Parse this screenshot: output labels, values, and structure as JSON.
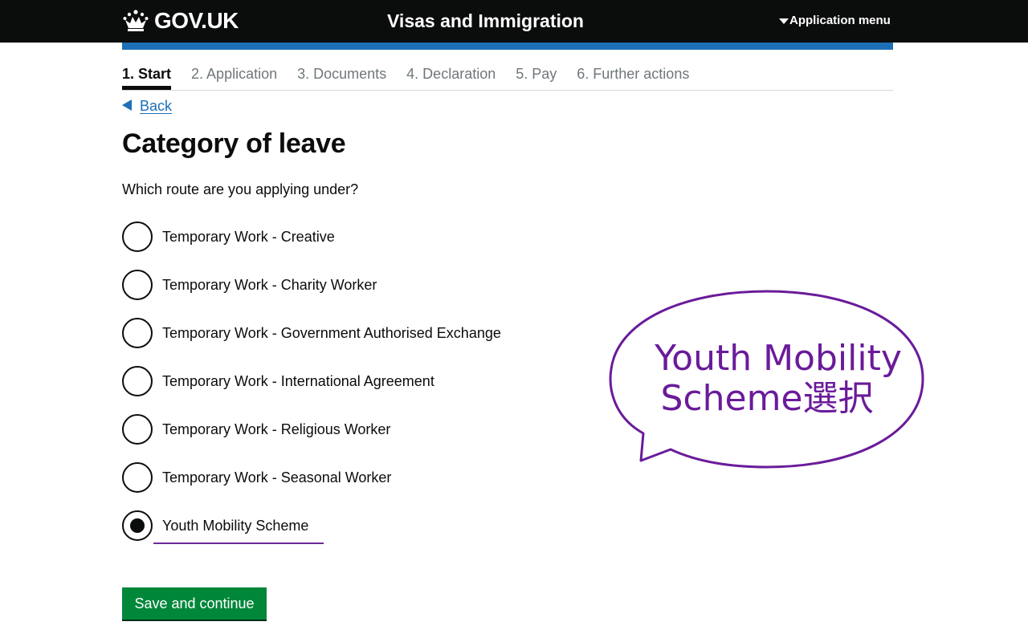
{
  "header": {
    "logo_text": "GOV.UK",
    "service_name": "Visas and Immigration",
    "menu_label": "Application menu"
  },
  "steps": [
    {
      "label": "1. Start",
      "current": true
    },
    {
      "label": "2. Application",
      "current": false
    },
    {
      "label": "3. Documents",
      "current": false
    },
    {
      "label": "4. Declaration",
      "current": false
    },
    {
      "label": "5. Pay",
      "current": false
    },
    {
      "label": "6. Further actions",
      "current": false
    }
  ],
  "back_label": "Back",
  "page_title": "Category of leave",
  "question": "Which route are you applying under?",
  "options": [
    {
      "label": "Temporary Work - Creative",
      "checked": false
    },
    {
      "label": "Temporary Work - Charity Worker",
      "checked": false
    },
    {
      "label": "Temporary Work - Government Authorised Exchange",
      "checked": false
    },
    {
      "label": "Temporary Work - International Agreement",
      "checked": false
    },
    {
      "label": "Temporary Work - Religious Worker",
      "checked": false
    },
    {
      "label": "Temporary Work - Seasonal Worker",
      "checked": false
    },
    {
      "label": "Youth Mobility Scheme",
      "checked": true
    }
  ],
  "save_button": "Save and continue",
  "annotation": {
    "line1": "Youth Mobility",
    "line2": "Scheme選択"
  },
  "colors": {
    "header_bg": "#0b0c0c",
    "accent_blue": "#1d70b8",
    "button_green": "#00873a",
    "annotation_purple": "#6a1b9a"
  }
}
